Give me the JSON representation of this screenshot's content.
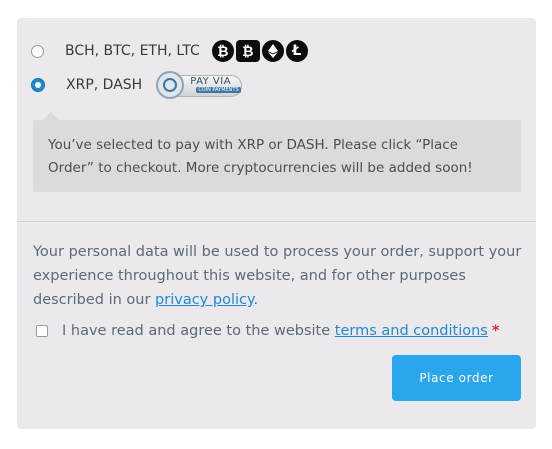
{
  "payment_methods": [
    {
      "label": "BCH, BTC, ETH, LTC",
      "selected": false,
      "icons": [
        "bitcoin-cash-icon",
        "bitcoin-icon",
        "ethereum-icon",
        "litecoin-icon"
      ]
    },
    {
      "label": "XRP, DASH",
      "selected": true,
      "badge": {
        "line1": "PAY VIA",
        "line2": "COIN PAYMENTS"
      }
    }
  ],
  "notice": "You’ve selected to pay with XRP or DASH. Please click “Place Order” to checkout. More cryptocurrencies will be added soon!",
  "privacy": {
    "text": "Your personal data will be used to process your order, support your experience throughout this website, and for other purposes described in our",
    "link": "privacy policy",
    "suffix": "."
  },
  "terms": {
    "text": "I have read and agree to the website",
    "link": "terms and conditions",
    "required_marker": "*",
    "checked": false
  },
  "place_order_label": "Place order",
  "colors": {
    "accent": "#2aa6ec",
    "link": "#1e8ad2",
    "required": "#e2263b",
    "panel": "#ebe9eb"
  }
}
